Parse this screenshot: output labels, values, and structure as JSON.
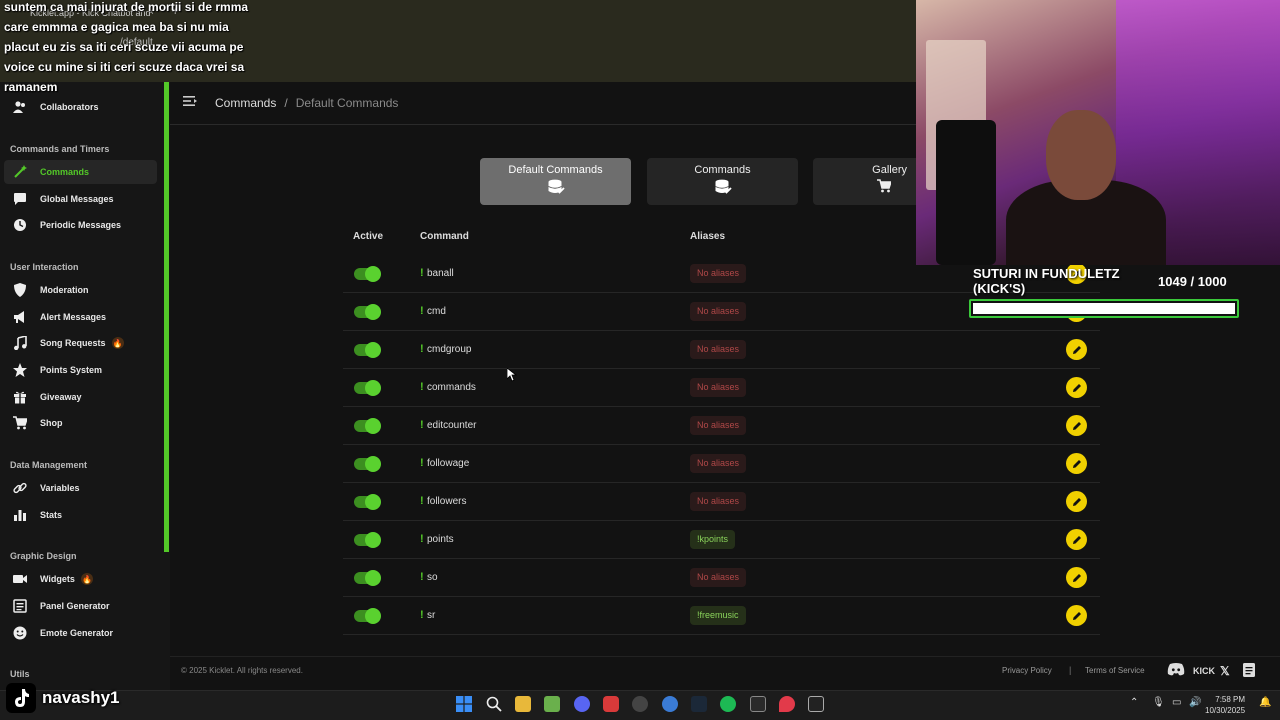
{
  "browser": {
    "tab_title": "Kicklet.app - Kick Chatbot and",
    "tab_close": "×",
    "tab_add": "+",
    "url_suffix": "/default"
  },
  "chat_overlay": {
    "lines": [
      "suntem ca mai injurat de mortii si de rmma",
      "care emmma e gagica mea ba si nu mia",
      "placut eu zis sa iti ceri scuze vii acuma pe",
      "voice cu mine si iti ceri scuze daca vrei sa",
      "ramanem"
    ]
  },
  "sidebar": {
    "items_top": [
      {
        "label": "Collaborators",
        "icon": "collaborators-icon"
      }
    ],
    "sections": [
      {
        "title": "Commands and Timers",
        "items": [
          {
            "label": "Commands",
            "icon": "wand-icon",
            "active": true
          },
          {
            "label": "Global Messages",
            "icon": "chat-bubble-icon"
          },
          {
            "label": "Periodic Messages",
            "icon": "clock-icon"
          }
        ]
      },
      {
        "title": "User Interaction",
        "items": [
          {
            "label": "Moderation",
            "icon": "shield-icon"
          },
          {
            "label": "Alert Messages",
            "icon": "megaphone-icon"
          },
          {
            "label": "Song Requests",
            "icon": "music-note-icon",
            "badge": "🔥"
          },
          {
            "label": "Points System",
            "icon": "star-icon"
          },
          {
            "label": "Giveaway",
            "icon": "gift-icon"
          },
          {
            "label": "Shop",
            "icon": "cart-icon"
          }
        ]
      },
      {
        "title": "Data Management",
        "items": [
          {
            "label": "Variables",
            "icon": "link-icon"
          },
          {
            "label": "Stats",
            "icon": "bar-chart-icon"
          }
        ]
      },
      {
        "title": "Graphic Design",
        "items": [
          {
            "label": "Widgets",
            "icon": "widgets-icon",
            "badge": "🔥"
          },
          {
            "label": "Panel Generator",
            "icon": "panel-icon"
          },
          {
            "label": "Emote Generator",
            "icon": "emote-icon"
          }
        ]
      },
      {
        "title": "Utils",
        "items": []
      }
    ]
  },
  "breadcrumb": {
    "parent": "Commands",
    "separator": "/",
    "current": "Default Commands"
  },
  "tabs": [
    {
      "label": "Default Commands",
      "icon": "database-icon",
      "active": true
    },
    {
      "label": "Commands",
      "icon": "database-icon",
      "active": false
    },
    {
      "label": "Gallery",
      "icon": "cart-icon",
      "active": false
    }
  ],
  "table": {
    "headers": {
      "active": "Active",
      "command": "Command",
      "aliases": "Aliases"
    },
    "prefix": "!",
    "rows": [
      {
        "command": "banall",
        "active": true,
        "alias": "No aliases",
        "has_alias": false
      },
      {
        "command": "cmd",
        "active": true,
        "alias": "No aliases",
        "has_alias": false
      },
      {
        "command": "cmdgroup",
        "active": true,
        "alias": "No aliases",
        "has_alias": false
      },
      {
        "command": "commands",
        "active": true,
        "alias": "No aliases",
        "has_alias": false
      },
      {
        "command": "editcounter",
        "active": true,
        "alias": "No aliases",
        "has_alias": false
      },
      {
        "command": "followage",
        "active": true,
        "alias": "No aliases",
        "has_alias": false
      },
      {
        "command": "followers",
        "active": true,
        "alias": "No aliases",
        "has_alias": false
      },
      {
        "command": "points",
        "active": true,
        "alias": "!kpoints",
        "has_alias": true
      },
      {
        "command": "so",
        "active": true,
        "alias": "No aliases",
        "has_alias": false
      },
      {
        "command": "sr",
        "active": true,
        "alias": "!freemusic",
        "has_alias": true
      }
    ]
  },
  "footer": {
    "copyright": "© 2025 Kicklet. All rights reserved.",
    "privacy": "Privacy Policy",
    "pipe": "|",
    "terms": "Terms of Service",
    "kick": "KICK",
    "x": "𝕏"
  },
  "goal": {
    "title": "SUTURI IN FUNDULETZ (KICK'S)",
    "count": "1049  / 1000",
    "progress": 1.0,
    "color": "#3ac93a"
  },
  "tiktok": {
    "username": "navashy1"
  },
  "taskbar": {
    "time": "7:58 PM",
    "date": "10/30/2025"
  },
  "colors": {
    "accent": "#53c828",
    "edit_button": "#f0d000",
    "alias_none": "#b04848",
    "alias_has": "#8ad35b"
  }
}
